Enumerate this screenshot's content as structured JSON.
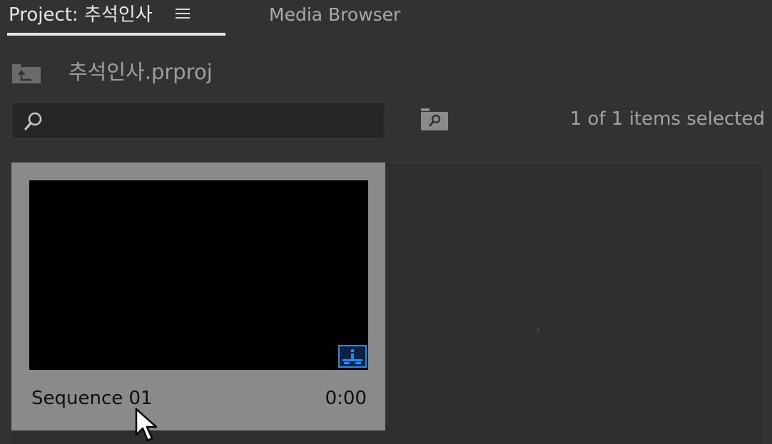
{
  "tabs": {
    "project_label": "Project: 추석인사",
    "media_browser_label": "Media Browser"
  },
  "project": {
    "file_name": "추석인사.prproj"
  },
  "search": {
    "value": "",
    "placeholder": ""
  },
  "status": {
    "selection_text": "1 of 1 items selected"
  },
  "items": [
    {
      "name": "Sequence 01",
      "duration": "0:00",
      "icon": "sequence-icon",
      "selected": true
    }
  ],
  "colors": {
    "panel_bg": "#323232",
    "selected_card_bg": "#8a8a8a",
    "thumbnail_bg": "#000000",
    "sequence_icon_blue": "#2d86e8"
  }
}
